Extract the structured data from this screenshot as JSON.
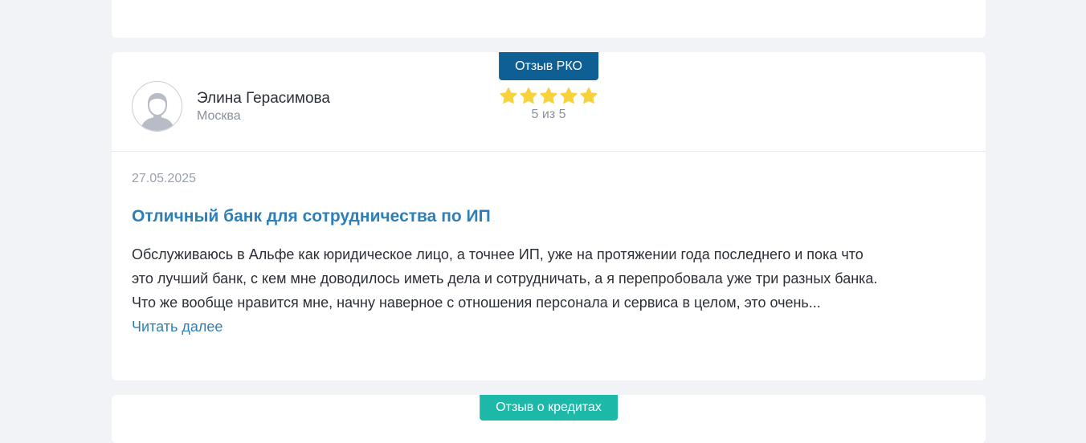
{
  "review": {
    "badge": "Отзыв РКО",
    "author_name": "Элина Герасимова",
    "author_city": "Москва",
    "rating": 5,
    "rating_text": "5 из 5",
    "date": "27.05.2025",
    "title": "Отличный банк для сотрудничества по ИП",
    "text_line1": "Обслуживаюсь в Альфе как юридическое лицо, а точнее ИП, уже на протяжении года последнего и пока что",
    "text_line2": "это лучший банк, с кем мне доводилось иметь дела и сотрудничать, а я перепробовала уже три разных банка.",
    "text_line3": "Что же вообще нравится мне, начну наверное с отношения персонала и сервиса в целом, это очень...",
    "read_more": "Читать далее"
  },
  "next_review": {
    "badge": "Отзыв о кредитах"
  },
  "colors": {
    "badge_rko": "#0e5f94",
    "badge_credit": "#1eb8a8",
    "star": "#f8d23c",
    "link": "#2d7fb8"
  },
  "icons": {
    "avatar": "user-avatar-icon",
    "star": "star-icon"
  }
}
